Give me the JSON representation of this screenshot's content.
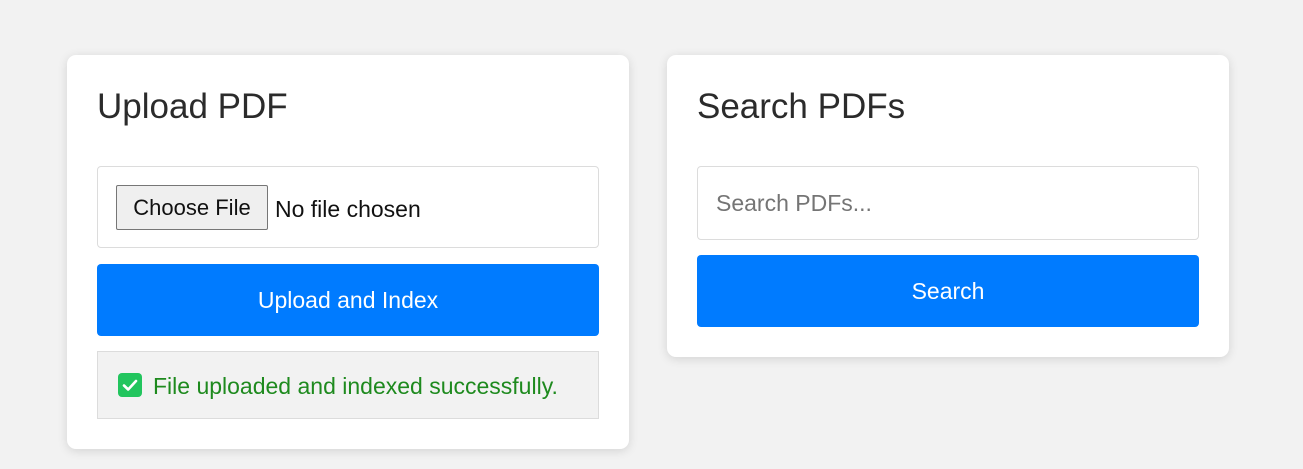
{
  "colors": {
    "background": "#f2f2f2",
    "primary": "#007bff",
    "success_text": "#1e8a1e",
    "success_icon": "#22c55e"
  },
  "upload_card": {
    "title": "Upload PDF",
    "choose_file_label": "Choose File",
    "file_status": "No file chosen",
    "upload_button_label": "Upload and Index",
    "message": {
      "icon": "check-icon",
      "text": "File uploaded and indexed successfully."
    }
  },
  "search_card": {
    "title": "Search PDFs",
    "input_value": "",
    "input_placeholder": "Search PDFs...",
    "search_button_label": "Search"
  }
}
